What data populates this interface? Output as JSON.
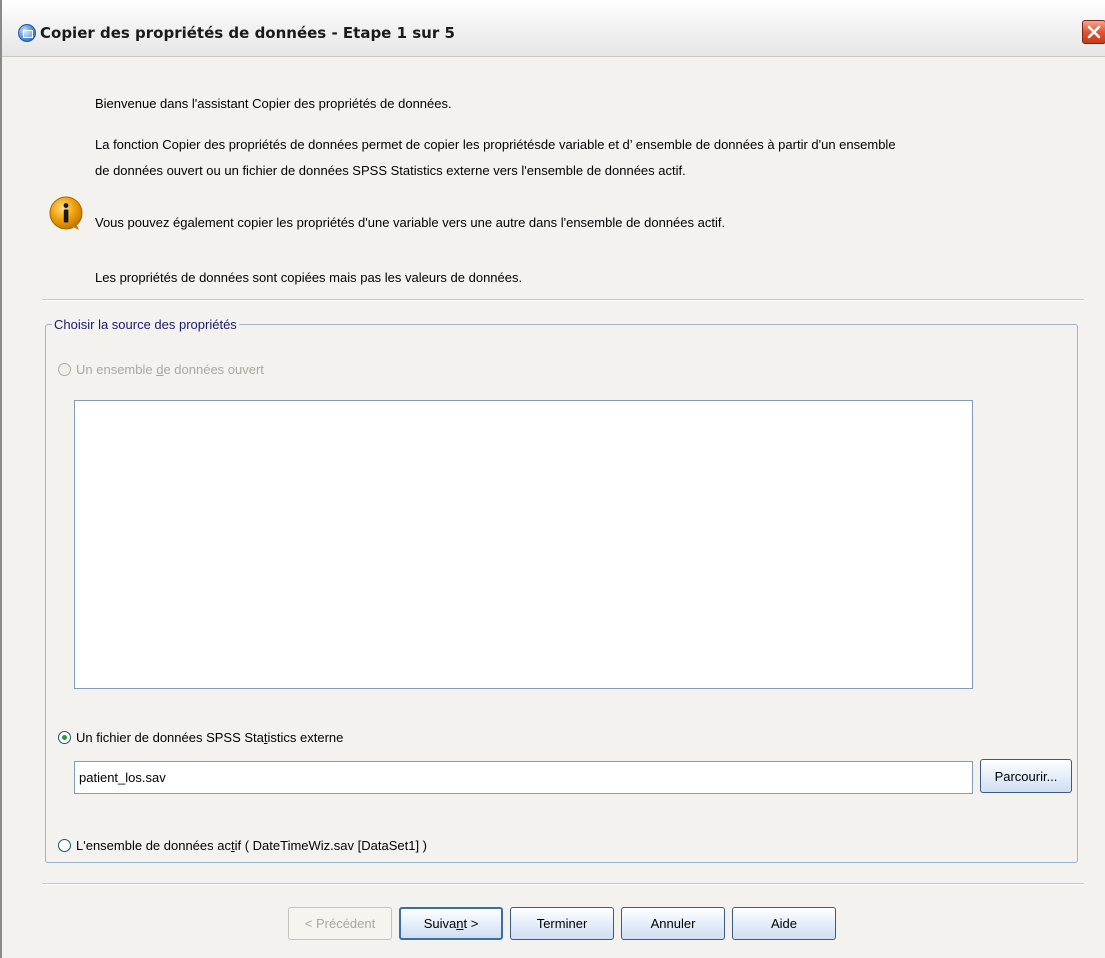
{
  "window": {
    "title": "Copier des propriétés de données - Etape 1 sur 5"
  },
  "intro": {
    "welcome": "Bienvenue dans l'assistant Copier des propriétés de données.",
    "description_line1": "La fonction Copier des propriétés de données permet de copier les propriétésde variable et d’  ensemble de données à partir d'un ensemble",
    "description_line2": "de données ouvert ou un fichier de données SPSS Statistics externe vers l'ensemble de données actif.",
    "variable_note": "Vous pouvez également copier les propriétés d'une variable vers une autre dans l'ensemble de données actif.",
    "values_note": "Les propriétés de données sont copiées mais pas les valeurs de données."
  },
  "source_group": {
    "legend": "Choisir la source des propriétés",
    "options": {
      "open_dataset": {
        "pre": "Un ensemble ",
        "accel": "d",
        "post": "e données ouvert",
        "selected": false,
        "enabled": false
      },
      "external_file": {
        "pre": "Un fichier de données SPSS Sta",
        "accel": "t",
        "post": "istics externe",
        "selected": true,
        "enabled": true
      },
      "active_dataset": {
        "pre": "L'ensemble de données ac",
        "accel": "t",
        "post": "if ( DateTimeWiz.sav [DataSet1] )",
        "selected": false,
        "enabled": true
      }
    },
    "file_path": "patient_los.sav",
    "browse_label": "Parcourir..."
  },
  "footer": {
    "previous": "< Précédent",
    "next_pre": "Suiva",
    "next_accel": "n",
    "next_post": "t >",
    "finish": "Terminer",
    "cancel": "Annuler",
    "help": "Aide"
  },
  "colors": {
    "dialog_bg": "#f3f2ee",
    "radio_selected": "#21a121",
    "close_button": "#e3532f",
    "info_icon": "#f0a30a",
    "group_border": "#9cb4cc"
  }
}
